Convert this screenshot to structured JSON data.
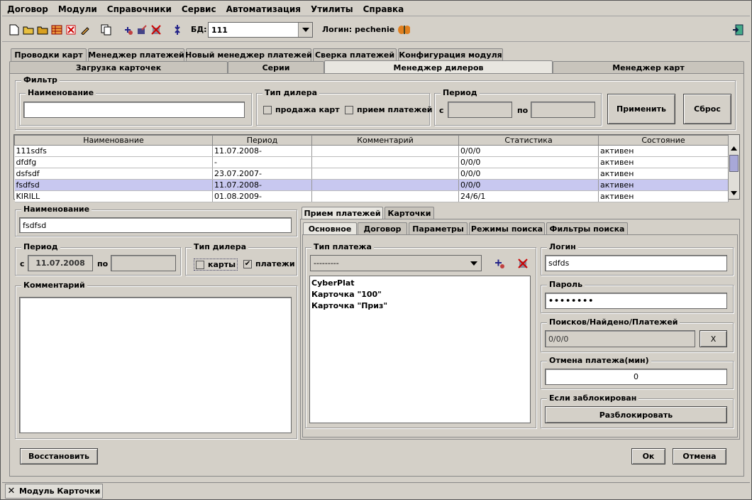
{
  "menu": [
    "Договор",
    "Модули",
    "Справочники",
    "Сервис",
    "Автоматизация",
    "Утилиты",
    "Справка"
  ],
  "toolbar": {
    "db_label": "БД:",
    "db_value": "111",
    "login_label": "Логин:",
    "login_value": "pechenie",
    "icons": [
      "new-file-icon",
      "open-folder-icon",
      "open-folder-alt-icon",
      "grid-icon",
      "delete-icon",
      "edit-icon",
      "copy-icon",
      "add-user-icon",
      "edit-user-icon",
      "delete-user-icon",
      "refresh-icon",
      "butterfly-icon",
      "exit-icon"
    ]
  },
  "tabs_row1": [
    "Проводки карт",
    "Менеджер платежей",
    "Новый менеджер платежей",
    "Сверка платежей",
    "Конфигурация модуля"
  ],
  "tabs_row2": [
    "Загрузка карточек",
    "Серии",
    "Менеджер дилеров",
    "Менеджер карт"
  ],
  "filter": {
    "title": "Фильтр",
    "name_title": "Наименование",
    "name_value": "",
    "type_title": "Тип дилера",
    "cb_cards": "продажа карт",
    "cb_payments": "прием платежей",
    "period_title": "Период",
    "from": "с",
    "to": "по",
    "apply": "Применить",
    "reset": "Сброс"
  },
  "table": {
    "headers": [
      "Наименование",
      "Период",
      "Комментарий",
      "Статистика",
      "Состояние"
    ],
    "rows": [
      [
        "111sdfs",
        "11.07.2008-",
        "",
        "0/0/0",
        "активен"
      ],
      [
        "dfdfg",
        "-",
        "",
        "0/0/0",
        "активен"
      ],
      [
        "dsfsdf",
        "23.07.2007-",
        "",
        "0/0/0",
        "активен"
      ],
      [
        "fsdfsd",
        "11.07.2008-",
        "",
        "0/0/0",
        "активен"
      ],
      [
        "KIRILL",
        "01.08.2009-",
        "",
        "24/6/1",
        "активен"
      ]
    ],
    "selected_row": 3
  },
  "detail": {
    "name_title": "Наименование",
    "name_value": "fsdfsd",
    "period_title": "Период",
    "from": "с",
    "from_value": "11.07.2008",
    "to": "по",
    "to_value": "",
    "type_title": "Тип дилера",
    "cb_cards": "карты",
    "cb_cards_checked": false,
    "cb_payments": "платежи",
    "cb_payments_checked": true,
    "comment_title": "Комментарий"
  },
  "right_tabs": [
    "Прием платежей",
    "Карточки"
  ],
  "sub_tabs": [
    "Основное",
    "Договор",
    "Параметры",
    "Режимы поиска",
    "Фильтры поиска"
  ],
  "payment": {
    "title": "Тип платежа",
    "combo_value": "---------",
    "items": [
      "CyberPlat",
      "Карточка \"100\"",
      "Карточка \"Приз\""
    ]
  },
  "login": {
    "title": "Логин",
    "value": "sdfds"
  },
  "password": {
    "title": "Пароль",
    "value": "••••••••"
  },
  "stats": {
    "title": "Поисков/Найдено/Платежей",
    "value": "0/0/0",
    "reset": "X"
  },
  "cancel_payment": {
    "title": "Отмена платежа(мин)",
    "value": "0"
  },
  "blocked": {
    "title": "Если заблокирован",
    "button": "Разблокировать"
  },
  "footer": {
    "restore": "Восстановить",
    "ok": "Ок",
    "cancel": "Отмена"
  },
  "status_tab": "Модуль Карточки"
}
